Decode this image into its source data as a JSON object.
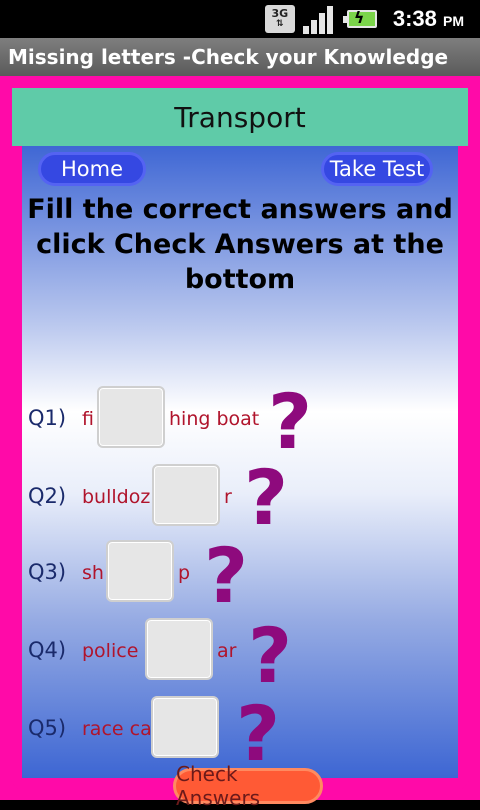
{
  "status_bar": {
    "network": "3G",
    "time": "3:38",
    "ampm": "PM"
  },
  "app": {
    "title": "Missing letters -Check your Knowledge"
  },
  "header": {
    "title": "Transport"
  },
  "nav": {
    "home": "Home",
    "take_test": "Take Test"
  },
  "instructions": {
    "line1": "Fill the correct answers and",
    "line2": "click Check Answers at the",
    "line3": "bottom"
  },
  "questions": [
    {
      "label": "Q1)",
      "prefix": "fi",
      "suffix": "hing boat",
      "answer": ""
    },
    {
      "label": "Q2)",
      "prefix": "bulldoz",
      "suffix": "r",
      "answer": ""
    },
    {
      "label": "Q3)",
      "prefix": "sh",
      "suffix": "p",
      "answer": ""
    },
    {
      "label": "Q4)",
      "prefix": "police",
      "suffix": "ar",
      "answer": ""
    },
    {
      "label": "Q5)",
      "prefix": "race ca",
      "suffix": "",
      "answer": ""
    }
  ],
  "question_mark": "?",
  "check_button": {
    "label": "Check Answers"
  },
  "colors": {
    "frame": "#ff0aa8",
    "header": "#5fcba8",
    "accent_blue": "#3548e2",
    "word_red": "#b0142c",
    "question_mark": "#8e0a7d",
    "check_button": "#ff5a35"
  }
}
